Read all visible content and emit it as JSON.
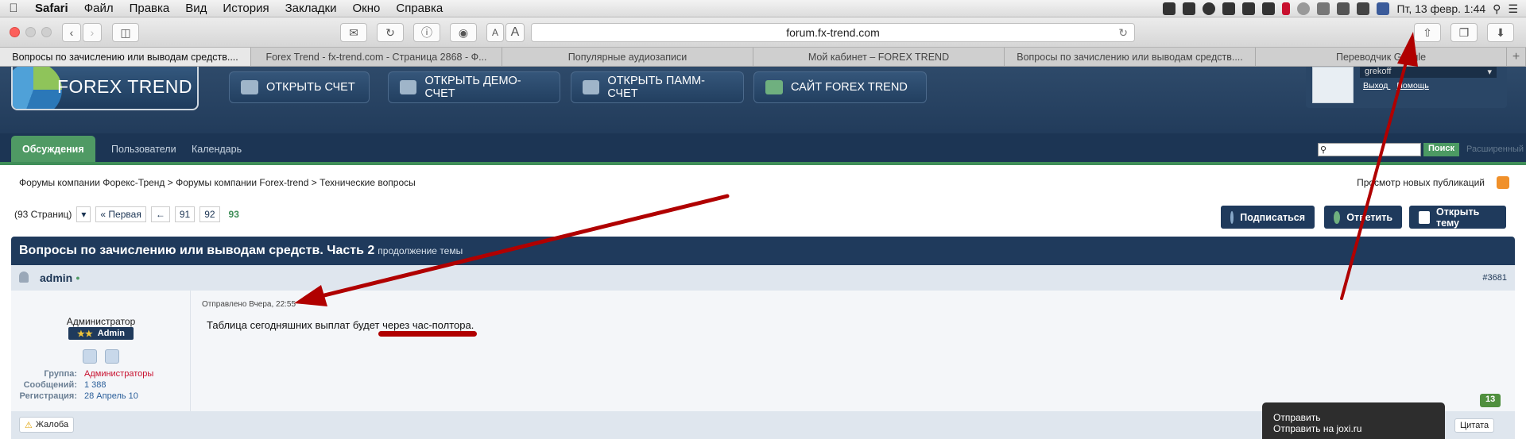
{
  "menubar": {
    "apple": "",
    "items": [
      "Safari",
      "Файл",
      "Правка",
      "Вид",
      "История",
      "Закладки",
      "Окно",
      "Справка"
    ],
    "clock": "Пт, 13 февр. 1:44"
  },
  "browser": {
    "url": "forum.fx-trend.com",
    "font_small": "A",
    "font_large": "A",
    "tabs": [
      "Вопросы по зачислению или выводам средств....",
      "Forex Trend - fx-trend.com - Страница 2868 - Ф...",
      "Популярные аудиозаписи",
      "Мой кабинет – FOREX TREND",
      "Вопросы по зачислению или выводам средств....",
      "Переводчик Google"
    ],
    "tab_plus": "+"
  },
  "site": {
    "logo_text": "FOREX TREND",
    "buttons": [
      "ОТКРЫТЬ СЧЕТ",
      "ОТКРЫТЬ ДЕМО-СЧЕТ",
      "ОТКРЫТЬ ПАММ-СЧЕТ",
      "САЙТ FOREX TREND"
    ],
    "user": {
      "name": "grekoff",
      "logout": "Выход",
      "help": "Помощь"
    },
    "nav": [
      "Обсуждения",
      "Пользователи",
      "Календарь"
    ],
    "search_button": "Поиск",
    "advanced": "Расширенный"
  },
  "breadcrumb": [
    "Форумы компании Форекс-Тренд",
    "Форумы компании Forex-trend",
    "Технические вопросы"
  ],
  "new_publications": "Просмотр новых публикаций",
  "pager": {
    "pages": "(93 Страниц)",
    "first": "« Первая",
    "prev": "←",
    "p1": "91",
    "p2": "92",
    "current": "93"
  },
  "actions": {
    "subscribe": "Подписаться",
    "reply": "Ответить",
    "new_topic": "Открыть тему"
  },
  "topic": {
    "title": "Вопросы по зачислению или выводам средств. Часть 2",
    "subtitle": "продолжение темы"
  },
  "post": {
    "author": "admin",
    "number": "#3681",
    "role": "Администратор",
    "badge": "Admin",
    "stars": "★★",
    "stats": [
      {
        "k": "Группа:",
        "v": "Администраторы"
      },
      {
        "k": "Сообщений:",
        "v": "1 388"
      },
      {
        "k": "Регистрация:",
        "v": "28 Апрель 10"
      }
    ],
    "posted": "Отправлено Вчера, 22:55",
    "text": "Таблица сегодняшних выплат будет через час-полтора.",
    "reputation": "13",
    "complain": "Жалоба",
    "quote": "Цитата"
  },
  "popup": {
    "line1": "Отправить",
    "line2": "Отправить на joxi.ru"
  },
  "colors": {
    "header": "#1c3554",
    "accent_green": "#3f8e58",
    "arrow_red": "#b00000"
  }
}
